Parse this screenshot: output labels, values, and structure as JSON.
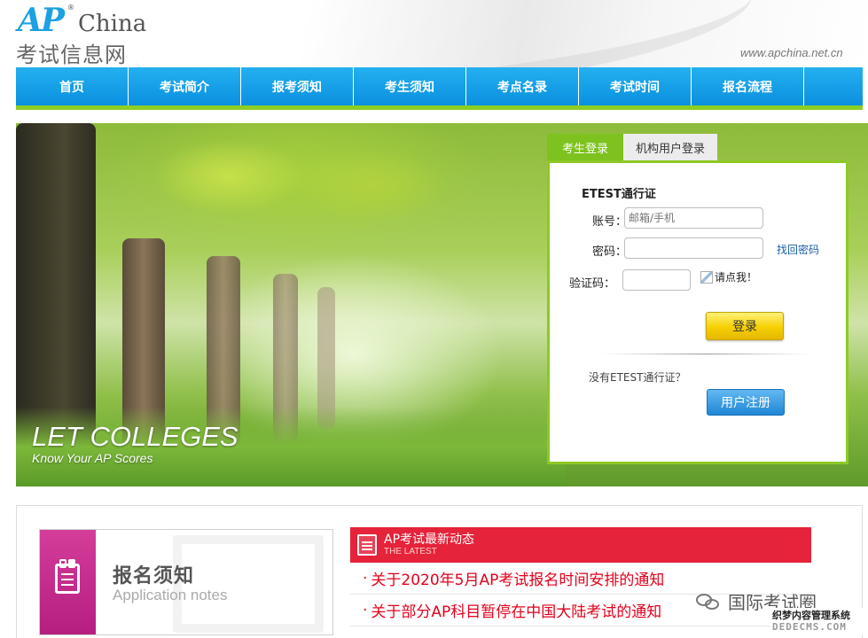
{
  "header": {
    "logo_ap": "AP",
    "logo_reg": "®",
    "logo_china": "China",
    "logo_subtitle": "考试信息网",
    "site_url": "www.apchina.net.cn"
  },
  "nav": {
    "items": [
      {
        "label": "首页"
      },
      {
        "label": "考试简介"
      },
      {
        "label": "报考须知"
      },
      {
        "label": "考生须知"
      },
      {
        "label": "考点名录"
      },
      {
        "label": "考试时间"
      },
      {
        "label": "报名流程"
      }
    ]
  },
  "banner": {
    "slogan_main": "LET COLLEGES",
    "slogan_sub": "Know Your AP Scores"
  },
  "login": {
    "tab_student": "考生登录",
    "tab_org": "机构用户登录",
    "etest_label": "ETEST通行证",
    "account_label": "账号：",
    "account_placeholder": "邮箱/手机",
    "password_label": "密码：",
    "find_password": "找回密码",
    "captcha_label": "验证码：",
    "captcha_click": "请点我！",
    "login_button": "登录",
    "no_etest": "没有ETEST通行证？",
    "register_button": "用户注册"
  },
  "application_notes": {
    "title_cn": "报名须知",
    "title_en": "Application notes"
  },
  "news": {
    "title": "AP考试最新动态",
    "subtitle": "THE LATEST",
    "items": [
      {
        "text": "关于2020年5月AP考试报名时间安排的通知"
      },
      {
        "text": "关于部分AP科目暂停在中国大陆考试的通知"
      }
    ]
  },
  "watermark": {
    "wechat_name": "国际考试圈",
    "dede_cn": "织梦内容管理系统",
    "dede_en": "DEDECMS.COM"
  },
  "colors": {
    "nav_blue": "#0a90df",
    "accent_green": "#8dc924",
    "news_red": "#e5233a",
    "notes_pink": "#c02988",
    "login_yellow": "#f6d000"
  }
}
